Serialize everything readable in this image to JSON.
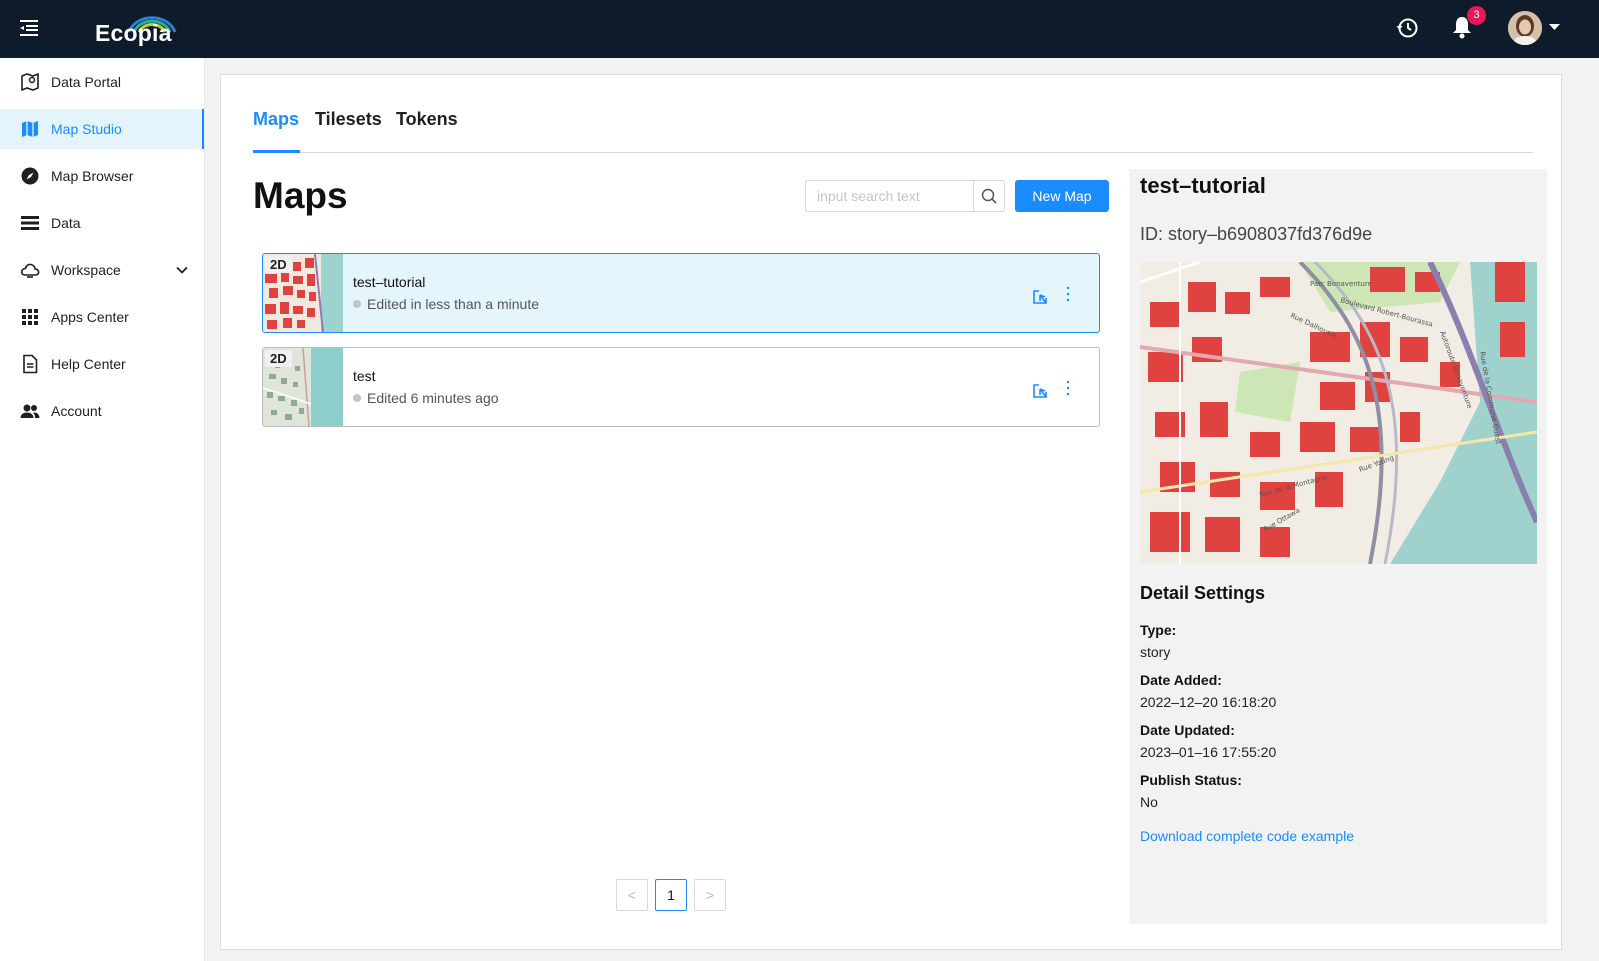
{
  "app": {
    "brand": "Ecopia",
    "notification_count": "3"
  },
  "icons": {
    "menu": "menu-fold-icon",
    "history": "history-icon",
    "bell": "bell-icon",
    "avatar": "user-avatar",
    "caret": "caret-down-icon"
  },
  "colors": {
    "topbar": "#0d1b2a",
    "accent": "#1a8cff",
    "badge": "#e8195a",
    "selected_card": "#e4f5fc"
  },
  "sidebar": {
    "items": [
      {
        "label": "Data Portal",
        "icon": "map-pin-icon"
      },
      {
        "label": "Map Studio",
        "icon": "map-icon",
        "active": true
      },
      {
        "label": "Map Browser",
        "icon": "compass-icon"
      },
      {
        "label": "Data",
        "icon": "list-icon"
      },
      {
        "label": "Workspace",
        "icon": "cloud-icon",
        "expandable": true
      },
      {
        "label": "Apps Center",
        "icon": "grid-icon"
      },
      {
        "label": "Help Center",
        "icon": "document-icon"
      },
      {
        "label": "Account",
        "icon": "team-icon"
      }
    ]
  },
  "tabs": [
    {
      "label": "Maps",
      "active": true
    },
    {
      "label": "Tilesets"
    },
    {
      "label": "Tokens"
    }
  ],
  "main": {
    "title": "Maps",
    "search_placeholder": "input search text",
    "new_map_label": "New Map"
  },
  "maps": [
    {
      "dimension": "2D",
      "name": "test–tutorial",
      "status": "Edited in less than a minute",
      "selected": true
    },
    {
      "dimension": "2D",
      "name": "test",
      "status": "Edited 6 minutes ago",
      "selected": false
    }
  ],
  "pagination": {
    "prev": "<",
    "current": "1",
    "next": ">"
  },
  "details": {
    "title": "test–tutorial",
    "id": "ID: story–b6908037fd376d9e",
    "settings_heading": "Detail Settings",
    "fields": [
      {
        "label": "Type:",
        "value": "story"
      },
      {
        "label": "Date Added:",
        "value": "2022–12–20 16:18:20"
      },
      {
        "label": "Date Updated:",
        "value": "2023–01–16 17:55:20"
      },
      {
        "label": "Publish Status:",
        "value": "No"
      }
    ],
    "download_link": "Download complete code example",
    "map_labels": [
      "Parc Bonaventure",
      "Boulevard Robert-Bourassa",
      "Rue Dalhousie",
      "Rue Young",
      "Rue de la Montagne",
      "Rue Ottawa",
      "Rue de la Commune Ouest",
      "Autoroute Bonaventure"
    ]
  }
}
